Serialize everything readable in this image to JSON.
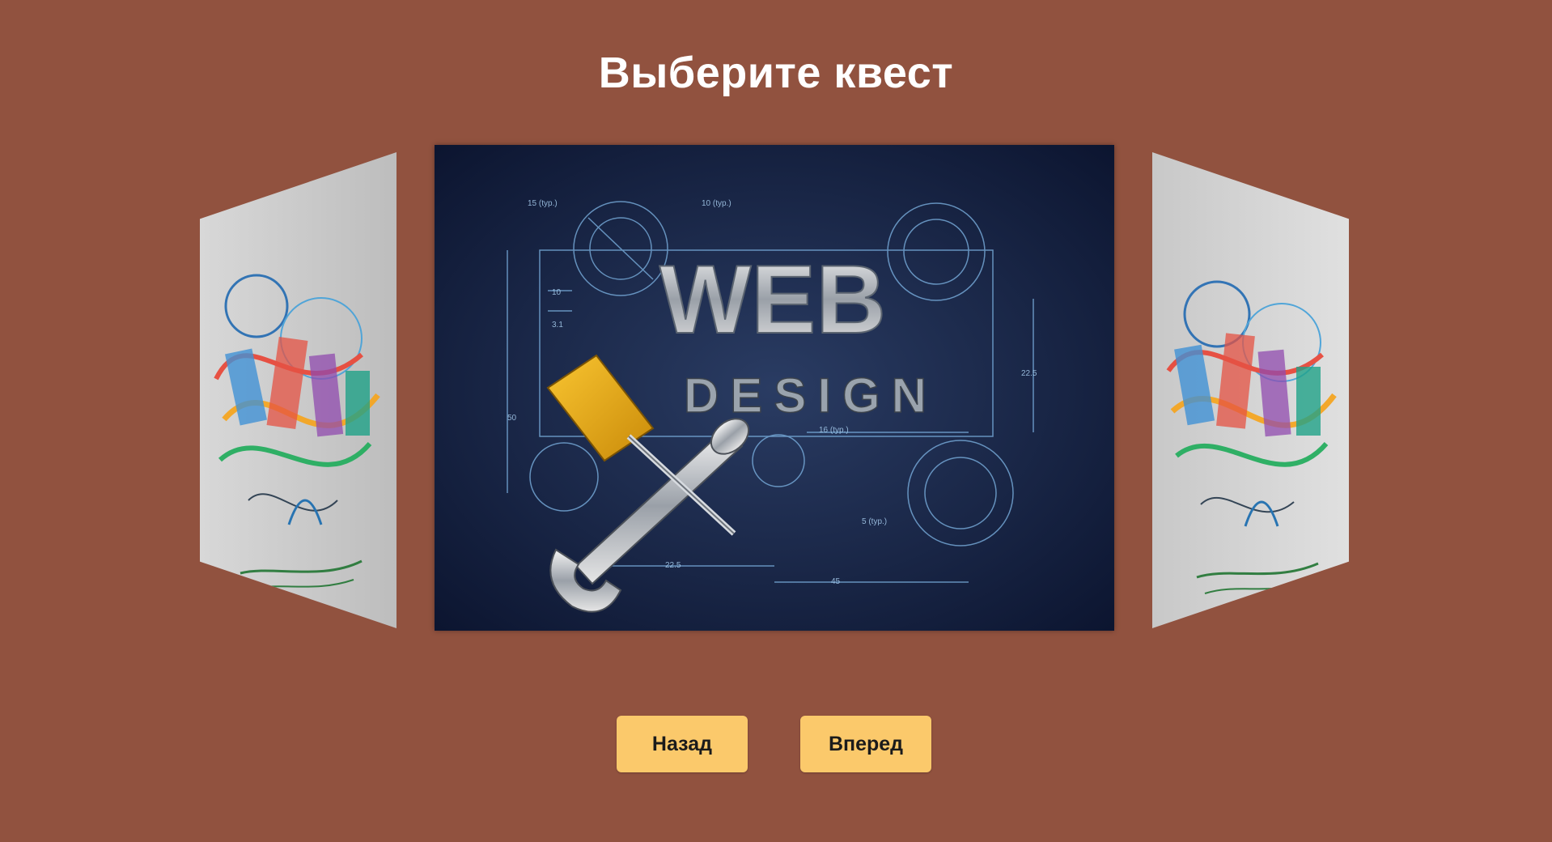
{
  "page": {
    "title": "Выберите квест",
    "background_color": "#91523f"
  },
  "carousel": {
    "center_card": {
      "image": "web-design-blueprint",
      "headline_word1": "WEB",
      "headline_word2": "DESIGN",
      "dimension_labels": [
        "15 (typ.)",
        "10 (typ.)",
        "10",
        "3.1",
        "50",
        "22.5",
        "16 (typ.)",
        "5 (typ.)",
        "22.5",
        "45"
      ]
    },
    "left_card": {
      "image": "graphic-splash-art"
    },
    "right_card": {
      "image": "graphic-splash-art"
    }
  },
  "buttons": {
    "back_label": "Назад",
    "next_label": "Вперед",
    "color": "#fbc96b"
  }
}
